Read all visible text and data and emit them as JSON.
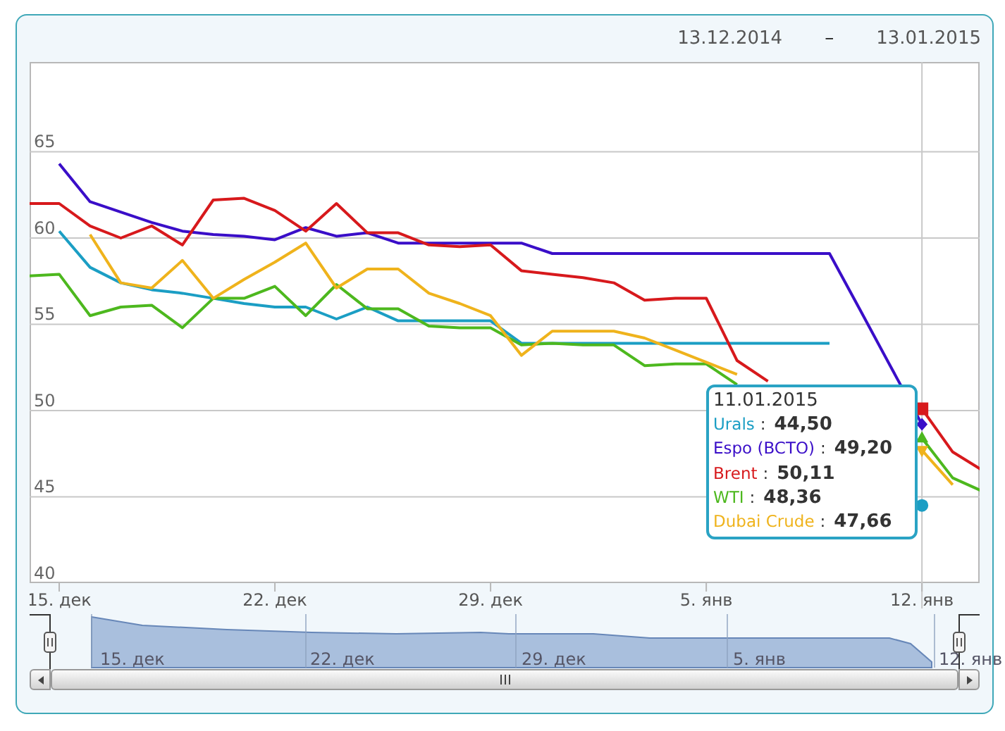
{
  "date_range": {
    "from": "13.12.2014",
    "separator": "–",
    "to": "13.01.2015"
  },
  "chart": {
    "chart_data": {
      "type": "line",
      "categories": [
        null,
        "15. дек",
        null,
        null,
        null,
        null,
        null,
        null,
        "22. дек",
        null,
        null,
        null,
        null,
        null,
        null,
        "29. дек",
        null,
        null,
        null,
        null,
        null,
        null,
        "5. янв",
        null,
        null,
        null,
        null,
        null,
        null,
        "12. янв",
        null,
        null
      ],
      "ylim": [
        40,
        70.2
      ],
      "yticks": [
        40,
        45,
        50,
        55,
        60,
        65
      ],
      "grid": true,
      "series": [
        {
          "name": "Urals",
          "color": "#1b9ec4",
          "values": [
            null,
            60.4,
            58.3,
            57.4,
            57.0,
            56.8,
            56.5,
            56.2,
            56.0,
            56.0,
            55.3,
            56.0,
            55.2,
            55.2,
            55.2,
            55.2,
            53.9,
            53.9,
            53.9,
            53.9,
            53.9,
            53.9,
            53.9,
            53.9,
            53.9,
            53.9,
            53.9,
            null,
            null,
            44.5,
            null,
            null
          ]
        },
        {
          "name": "Espo (BCTO)",
          "color": "#3a0ec8",
          "values": [
            null,
            64.3,
            62.1,
            61.5,
            60.9,
            60.4,
            60.2,
            60.1,
            59.9,
            60.6,
            60.1,
            60.3,
            59.7,
            59.7,
            59.7,
            59.7,
            59.7,
            59.1,
            59.1,
            59.1,
            59.1,
            59.1,
            59.1,
            59.1,
            59.1,
            59.1,
            59.1,
            55.8,
            52.5,
            49.2,
            null,
            null
          ]
        },
        {
          "name": "Brent",
          "color": "#d7191c",
          "values": [
            62.0,
            62.0,
            60.7,
            60.0,
            60.7,
            59.6,
            62.2,
            62.3,
            61.6,
            60.4,
            62.0,
            60.3,
            60.3,
            59.6,
            59.5,
            59.6,
            58.1,
            57.9,
            57.7,
            57.4,
            56.4,
            56.5,
            56.5,
            52.9,
            51.7,
            null,
            null,
            null,
            null,
            50.1,
            47.6,
            46.5
          ]
        },
        {
          "name": "WTI",
          "color": "#4db81e",
          "values": [
            57.8,
            57.9,
            55.5,
            56.0,
            56.1,
            54.8,
            56.5,
            56.5,
            57.2,
            55.5,
            57.3,
            55.9,
            55.9,
            54.9,
            54.8,
            54.8,
            53.8,
            53.9,
            53.8,
            53.8,
            52.6,
            52.7,
            52.7,
            51.5,
            null,
            null,
            null,
            null,
            null,
            48.4,
            46.1,
            45.3
          ]
        },
        {
          "name": "Dubai Crude",
          "color": "#efb31c",
          "values": [
            null,
            null,
            60.2,
            57.4,
            57.1,
            58.7,
            56.5,
            57.6,
            58.6,
            59.7,
            57.1,
            58.2,
            58.2,
            56.8,
            56.2,
            55.5,
            53.2,
            54.6,
            54.6,
            54.6,
            54.2,
            53.5,
            52.8,
            52.1,
            null,
            null,
            null,
            null,
            null,
            47.7,
            45.7,
            null
          ]
        }
      ],
      "annotations": [
        {
          "x": "12. янв"
        }
      ]
    },
    "tooltip": {
      "date": "11.01.2015",
      "rows": [
        {
          "sep": ":",
          "value": "44,50",
          "kind": "circle"
        },
        {
          "sep": ":",
          "value": "49,20",
          "kind": "diamond"
        },
        {
          "sep": ":",
          "value": "50,11",
          "kind": "square"
        },
        {
          "sep": ":",
          "value": "48,36",
          "kind": "triangle-up"
        },
        {
          "sep": ":",
          "value": "47,66",
          "kind": "triangle-down"
        }
      ]
    }
  },
  "navigator": {
    "labels": [
      "15. дек",
      "22. дек",
      "29. дек",
      "5. янв",
      "12. янв"
    ]
  }
}
